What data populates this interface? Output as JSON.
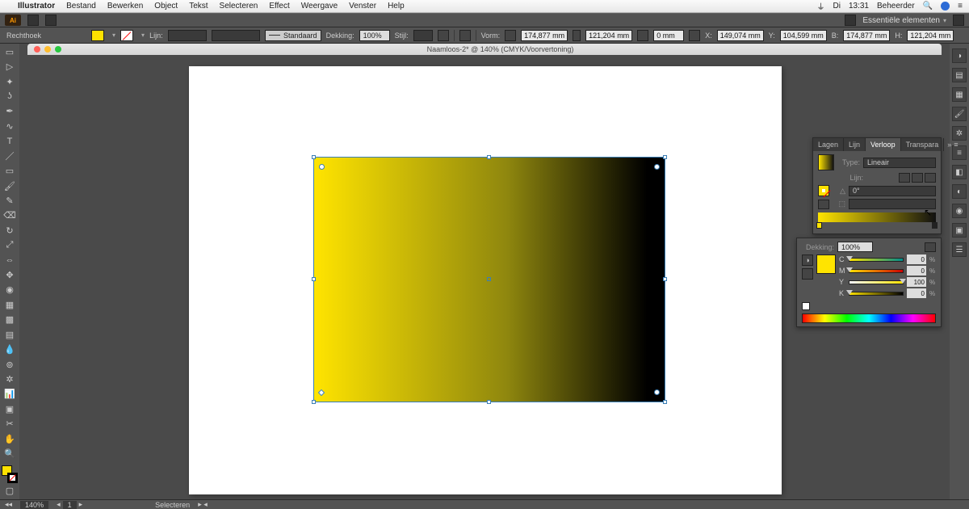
{
  "mac_menu": {
    "app": "Illustrator",
    "items": [
      "Bestand",
      "Bewerken",
      "Object",
      "Tekst",
      "Selecteren",
      "Effect",
      "Weergave",
      "Venster",
      "Help"
    ],
    "day": "Di",
    "time": "13:31",
    "user": "Beheerder"
  },
  "ai_bar": {
    "logo": "Ai",
    "workspace": "Essentiële elementen"
  },
  "control": {
    "shape": "Rechthoek",
    "lijn_label": "Lijn:",
    "profile": "Standaard",
    "dekking_label": "Dekking:",
    "dekking": "100%",
    "stijl_label": "Stijl:",
    "vorm_label": "Vorm:",
    "w": "174,877 mm",
    "h": "121,204 mm",
    "radius": "0 mm",
    "x_label": "X:",
    "x": "149,074 mm",
    "y_label": "Y:",
    "y": "104,599 mm",
    "b_label": "B:",
    "b": "174,877 mm",
    "h_label": "H:",
    "h2": "121,204 mm"
  },
  "doc_title": "Naamloos-2* @ 140% (CMYK/Voorvertoning)",
  "panels": {
    "tabs": [
      "Lagen",
      "Lijn",
      "Verloop",
      "Transpara"
    ],
    "active_tab": "Verloop",
    "type_label": "Type:",
    "type_value": "Lineair",
    "lijn_label": "Lijn:",
    "angle": "0°",
    "dekking_label": "Dekking:",
    "dekking": "100%",
    "cmyk": {
      "c": "0",
      "m": "0",
      "y": "100",
      "k": "0"
    }
  },
  "status": {
    "zoom": "140%",
    "artboard": "1",
    "tool": "Selecteren"
  }
}
